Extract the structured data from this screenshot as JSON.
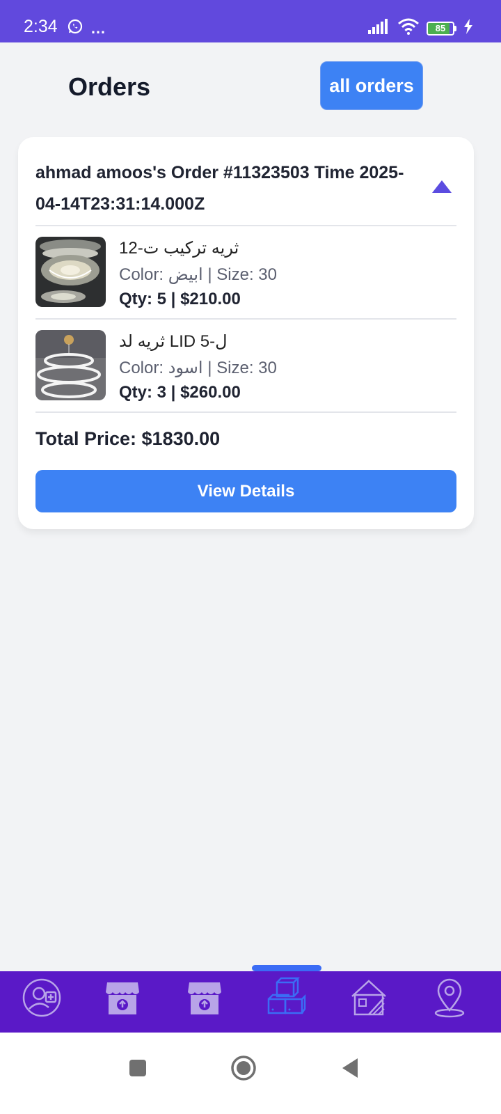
{
  "status_bar": {
    "time": "2:34",
    "more": "…",
    "battery_level": "85",
    "battery_fraction": 0.85,
    "icons": [
      "whatsapp-icon",
      "signal-icon",
      "wifi-icon",
      "battery-icon",
      "charging-icon"
    ]
  },
  "header": {
    "title": "Orders",
    "all_orders_label": "all orders"
  },
  "order": {
    "title": "ahmad amoos's Order #11323503 Time 2025-04-14T23:31:14.000Z",
    "items": [
      {
        "name": "ثريه تركيب ت-12",
        "attrs": "Color: ابيض | Size: 30",
        "qty_price": "Qty: 5 | $210.00"
      },
      {
        "name": "ثريه لد LID ل-5",
        "attrs": "Color: اسود | Size: 30",
        "qty_price": "Qty: 3 | $260.00"
      }
    ],
    "total_price": "Total Price: $1830.00",
    "view_details_label": "View Details"
  },
  "bottom_nav": {
    "items": [
      "profile-add-icon",
      "store-upload-icon",
      "store-upload-icon",
      "boxes-icon",
      "property-icon",
      "location-pin-icon"
    ],
    "active_index": 3
  },
  "colors": {
    "status_bar": "#6149dd",
    "bottom_nav": "#5a19c7",
    "accent_blue": "#3d82f4",
    "collapse_icon": "#5b4ce0",
    "active_nav": "#3b6cf5",
    "inactive_nav": "#b8a4e8"
  }
}
